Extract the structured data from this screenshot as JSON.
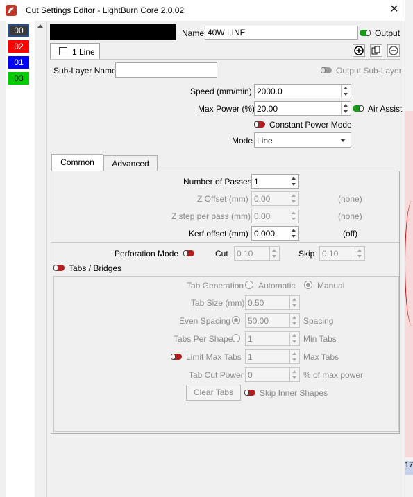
{
  "window": {
    "title": "Cut Settings Editor - LightBurn Core 2.0.02"
  },
  "layers": [
    {
      "label": "00",
      "color": "#3a3a3a",
      "selected": true
    },
    {
      "label": "02",
      "color": "#ff0000"
    },
    {
      "label": "01",
      "color": "#0000ff"
    },
    {
      "label": "03",
      "color": "#00cc00"
    }
  ],
  "header": {
    "name_label": "Name",
    "name_value": "40W LINE",
    "output_label": "Output",
    "sublayer_tab": "1 Line",
    "sublayer_name_label": "Sub-Layer Name",
    "sublayer_name_value": "",
    "output_sublayer_label": "Output Sub-Layer"
  },
  "settings": {
    "speed_label": "Speed (mm/min)",
    "speed_value": "2000.0",
    "maxpower_label": "Max Power (%)",
    "maxpower_value": "20.00",
    "air_assist_label": "Air Assist",
    "constant_power_label": "Constant Power Mode",
    "mode_label": "Mode",
    "mode_value": "Line"
  },
  "tabs": {
    "common": "Common",
    "advanced": "Advanced"
  },
  "common": {
    "passes_label": "Number of Passes",
    "passes_value": "1",
    "zoffset_label": "Z Offset (mm)",
    "zoffset_value": "0.00",
    "zoffset_note": "(none)",
    "zstep_label": "Z step per pass (mm)",
    "zstep_value": "0.00",
    "zstep_note": "(none)",
    "kerf_label": "Kerf offset (mm)",
    "kerf_value": "0.000",
    "kerf_note": "(off)",
    "perforation_label": "Perforation Mode",
    "cut_label": "Cut",
    "cut_value": "0.10",
    "skip_label": "Skip",
    "skip_value": "0.10",
    "tabs_bridges_label": "Tabs / Bridges",
    "tab_generation_label": "Tab Generation",
    "automatic_label": "Automatic",
    "manual_label": "Manual",
    "tab_size_label": "Tab Size (mm)",
    "tab_size_value": "0.50",
    "even_spacing_label": "Even Spacing",
    "spacing_value": "50.00",
    "spacing_label": "Spacing",
    "tabs_per_shape_label": "Tabs Per Shape",
    "tabs_per_shape_value": "1",
    "min_tabs_label": "Min Tabs",
    "limit_max_tabs_label": "Limit Max Tabs",
    "max_tabs_value": "1",
    "max_tabs_label": "Max Tabs",
    "tab_cut_power_label": "Tab Cut Power",
    "tab_cut_power_value": "0",
    "pct_max_power_label": "% of max power",
    "clear_tabs_label": "Clear Tabs",
    "skip_inner_label": "Skip Inner Shapes"
  },
  "background": {
    "corner_text": "17"
  }
}
